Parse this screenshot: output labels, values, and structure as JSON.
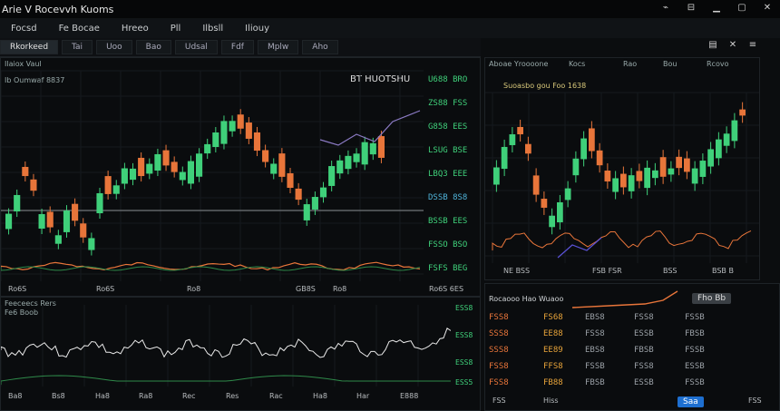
{
  "window": {
    "title": "Arie V Rocevvh Kuoms"
  },
  "menu": [
    "Focsd",
    "Fe Bocae",
    "Hreeo",
    "Pll",
    "Ilbsll",
    "Iliouy"
  ],
  "tabs": [
    "Rkorkeed",
    "Tai",
    "Uoo",
    "Bao",
    "Udsal",
    "Fdf",
    "Mplw",
    "Aho"
  ],
  "toolbar_right": [
    "chart-icon",
    "close-icon",
    "menu-icon"
  ],
  "main_chart": {
    "header": "Ilaiox Vaul",
    "sub_header": "Ib Oumwaf 8837",
    "ticker_label": "BT HUOTSHU",
    "price_labels": [
      "U688 BRO",
      "ZS88 FSS",
      "G858 EES",
      "LSUG BSE",
      "LBQ3 EEE",
      "DSSB 8S8",
      "BSSB EES",
      "FSSO BSO",
      "FSFS BEG"
    ],
    "x_labels": [
      "Ro6S",
      "Ro6S",
      "Ro8",
      "GB8S",
      "Ro8"
    ],
    "x_right": "Ro6S 6ES"
  },
  "oscillator": {
    "header": "Feeceecs Rers",
    "sub": "Fe6 Boob",
    "right_labels": [
      "ESS8",
      "ESS8",
      "ESS8",
      "ESS5"
    ],
    "x_labels": [
      "Ba8",
      "Bs8",
      "Ha8",
      "Ra8",
      "Rec",
      "Res",
      "Rac",
      "Ha8",
      "Har",
      "E888"
    ]
  },
  "right_chart": {
    "header": "Aboae Yroooone",
    "header_right": [
      "Kocs",
      "Rao",
      "Bou",
      "Rcovo"
    ],
    "legend": "Suoasbo gou  Foo 1638",
    "x_labels": [
      "NE BSS",
      "FSB FSR",
      "BSS",
      "BSB B"
    ]
  },
  "order_book": {
    "header": "Rocaooo Hao Wuaoo",
    "pill_right": "Fho Bb",
    "rows": [
      [
        "FSS8",
        "FS68",
        "EBS8",
        "FSS8",
        "FSSB"
      ],
      [
        "SSS8",
        "EE88",
        "FSS8",
        "ESSB",
        "FBSB"
      ],
      [
        "SSS8",
        "EE89",
        "EBS8",
        "FBSB",
        "FSSB"
      ],
      [
        "FSS8",
        "FFS8",
        "FSSB",
        "FSS8",
        "ESSB"
      ],
      [
        "FSS8",
        "FB88",
        "FBSB",
        "ESSB",
        "FSSB"
      ]
    ],
    "footer": [
      "FSS",
      "Hiss",
      "Saa",
      "FSS"
    ]
  },
  "colors": {
    "bg": "#0b0d0f",
    "up": "#3fd07a",
    "down": "#e8753a",
    "accent": "#4fb3d9",
    "border": "#1e2327"
  }
}
